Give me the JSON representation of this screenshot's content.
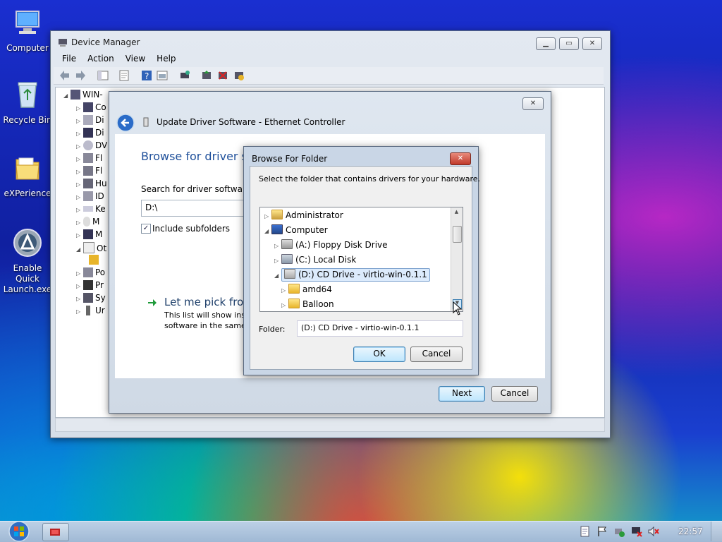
{
  "desktop": {
    "icons": [
      {
        "label": "Computer"
      },
      {
        "label": "Recycle Bin"
      },
      {
        "label": "eXPerience"
      },
      {
        "label": "Enable Quick Launch.exe"
      }
    ]
  },
  "device_manager": {
    "title": "Device Manager",
    "menu": [
      "File",
      "Action",
      "View",
      "Help"
    ],
    "tree_root": "WIN-",
    "tree_items": [
      "Co",
      "Di",
      "Di",
      "DV",
      "Fl",
      "Fl",
      "Hu",
      "ID",
      "Ke",
      "M",
      "M",
      "Ot",
      "",
      "Po",
      "Pr",
      "Sy",
      "Ur"
    ]
  },
  "update_driver": {
    "title": "Update Driver Software - Ethernet Controller",
    "heading": "Browse for driver sof",
    "search_label": "Search for driver software in",
    "path_value": "D:\\",
    "include_subfolders": "Include subfolders",
    "pick_title": "Let me pick from",
    "pick_desc_1": "This list will show inst",
    "pick_desc_2": "software in the same",
    "next": "Next",
    "cancel": "Cancel"
  },
  "browse_folder": {
    "title": "Browse For Folder",
    "instruction": "Select the folder that contains drivers for your hardware.",
    "tree": [
      {
        "label": "Administrator",
        "level": 0,
        "expanded": false
      },
      {
        "label": "Computer",
        "level": 0,
        "expanded": true
      },
      {
        "label": "(A:) Floppy Disk Drive",
        "level": 1,
        "expanded": false
      },
      {
        "label": "(C:) Local Disk",
        "level": 1,
        "expanded": false
      },
      {
        "label": "(D:) CD Drive - virtio-win-0.1.1",
        "level": 1,
        "expanded": true,
        "selected": true
      },
      {
        "label": "amd64",
        "level": 2,
        "expanded": false
      },
      {
        "label": "Balloon",
        "level": 2,
        "expanded": false
      }
    ],
    "folder_label": "Folder:",
    "folder_value": "(D:) CD Drive - virtio-win-0.1.1",
    "ok": "OK",
    "cancel": "Cancel"
  },
  "taskbar": {
    "clock": "22:57"
  }
}
